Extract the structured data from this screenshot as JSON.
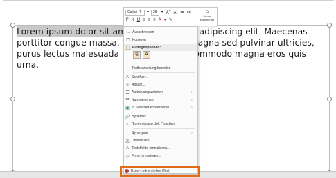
{
  "paragraph": {
    "selected": "Lorem ipsum dolor sit amet,",
    "rest": " consectetuer adipiscing elit. Maecenas porttitor congue massa. Fusce posuere, magna sed pulvinar ultricies, purus lectus malesuada libero, sit amet commodo magna eros quis urna."
  },
  "mini_toolbar": {
    "font": "Calibri (T",
    "size": "28",
    "new_comment_line1": "Neuer",
    "new_comment_line2": "Kommentar"
  },
  "menu": {
    "cut": "Ausschneiden",
    "copy": "Kopieren",
    "paste_header": "Einfügeoptionen:",
    "exit_edit": "Textbearbeitung beenden",
    "font": "Schriftart...",
    "paragraph": "Absatz...",
    "bullets": "Aufzählungszeichen",
    "numbering": "Nummerierung",
    "smartart": "In SmartArt konvertieren",
    "hyperlink": "Hyperlink...",
    "search": "\"Lorem ipsum dol...\" suchen",
    "synonyms": "Synonyme",
    "translate": "Übersetzen",
    "text_effects": "Texteffekte formatieren...",
    "format_shape": "Form formatieren...",
    "excel_link": "Excel-Link erstellen (Text)"
  },
  "colors": {
    "highlight": "#e26b17"
  }
}
